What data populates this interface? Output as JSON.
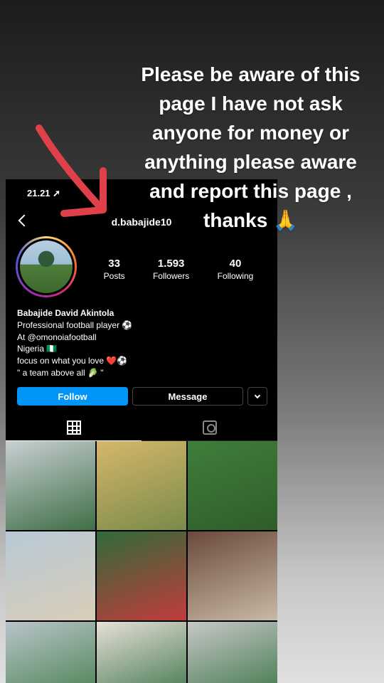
{
  "story": {
    "message": "Please be aware of this page I have not ask anyone for money or anything please aware and report this page , thanks",
    "emoji": "🙏"
  },
  "status_bar": {
    "time": "21.21"
  },
  "profile": {
    "username": "d.babajide10",
    "stats": [
      {
        "value": "33",
        "label": "Posts"
      },
      {
        "value": "1.593",
        "label": "Followers"
      },
      {
        "value": "40",
        "label": "Following"
      }
    ],
    "bio": {
      "name": "Babajide David Akintola",
      "lines": [
        "Professional football player ⚽",
        "At @omonoiafootball",
        "Nigeria 🇳🇬",
        "focus on what you love ❤️⚽",
        "\" a team above all 🥬 \""
      ]
    },
    "buttons": {
      "follow": "Follow",
      "message": "Message"
    }
  },
  "colors": {
    "follow_blue": "#0095f6",
    "arrow_red": "#e0404a"
  },
  "photos": [
    {
      "color_a": "#c8cfd3",
      "color_b": "#3f6e45"
    },
    {
      "color_a": "#d5b76a",
      "color_b": "#7a8a4a"
    },
    {
      "color_a": "#3f7e3a",
      "color_b": "#2f5d2a"
    },
    {
      "color_a": "#b7c9d6",
      "color_b": "#d9cdb8"
    },
    {
      "color_a": "#2f6b3a",
      "color_b": "#c23b3b"
    },
    {
      "color_a": "#6a4a3a",
      "color_b": "#c9b9a6"
    },
    {
      "color_a": "#b9c4c9",
      "color_b": "#3e7a44"
    },
    {
      "color_a": "#e6e0d6",
      "color_b": "#2e6a3e"
    },
    {
      "color_a": "#c7c7c7",
      "color_b": "#2f6e3b"
    }
  ]
}
